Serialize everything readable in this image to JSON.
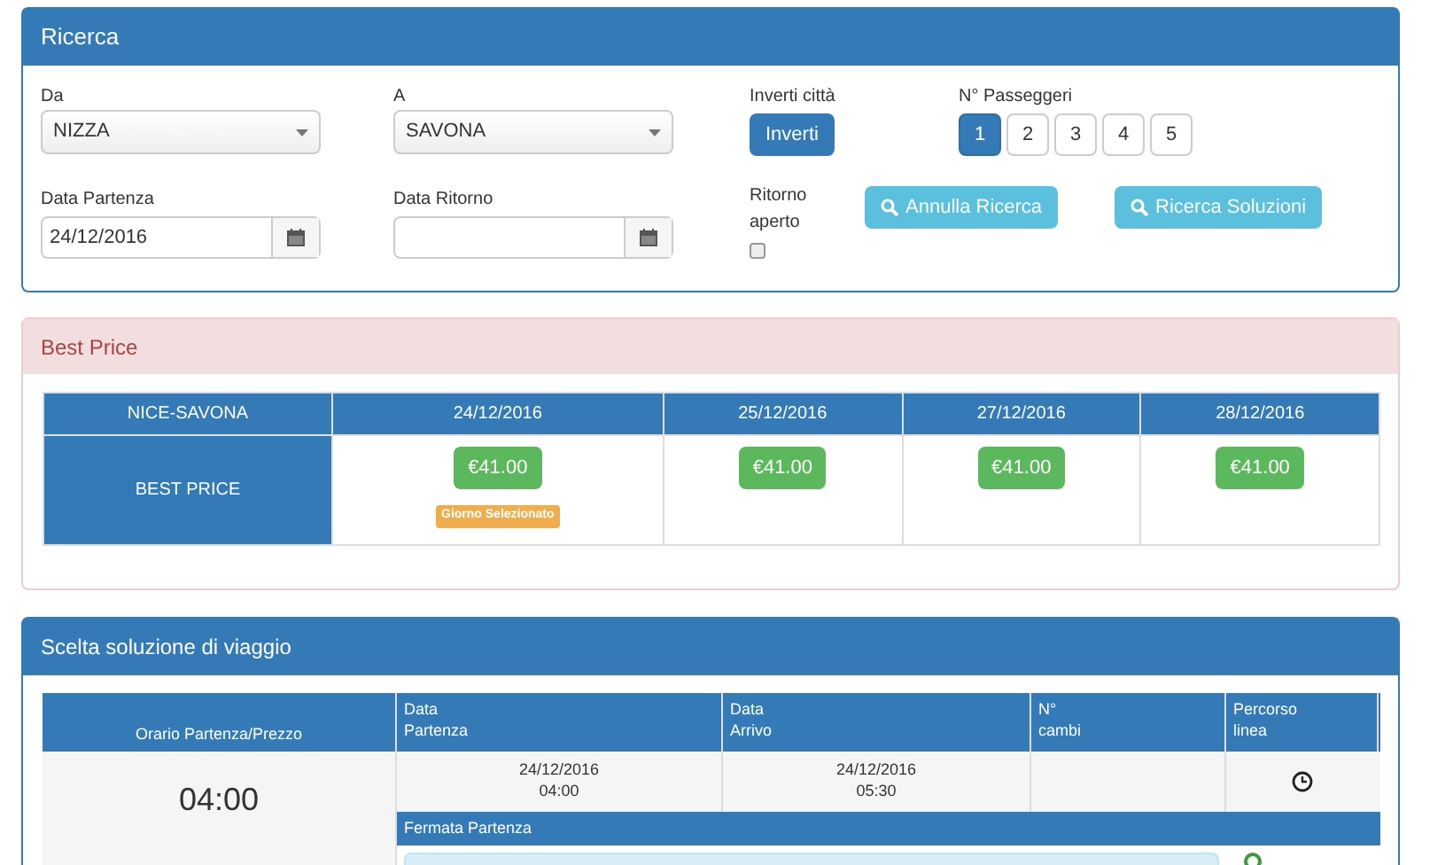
{
  "search_panel": {
    "title": "Ricerca",
    "from": {
      "label": "Da",
      "value": "NIZZA"
    },
    "to": {
      "label": "A",
      "value": "SAVONA"
    },
    "swap": {
      "label": "Inverti città",
      "button": "Inverti"
    },
    "passengers": {
      "label": "N° Passeggeri",
      "options": [
        {
          "label": "1",
          "selected": true
        },
        {
          "label": "2",
          "selected": false
        },
        {
          "label": "3",
          "selected": false
        },
        {
          "label": "4",
          "selected": false
        },
        {
          "label": "5",
          "selected": false
        }
      ]
    },
    "departure_date": {
      "label": "Data Partenza",
      "value": "24/12/2016"
    },
    "return_date": {
      "label": "Data Ritorno"
    },
    "open_return": {
      "label": "Ritorno aperto",
      "checked": false
    },
    "buttons": [
      "Annulla Ricerca",
      "Ricerca Soluzioni"
    ]
  },
  "best_price_panel": {
    "title": "Best Price",
    "route": "NICE-SAVONA",
    "row_label": "BEST PRICE",
    "days": [
      {
        "date": "24/12/2016",
        "price": "€41.00",
        "badge": "Giorno Selezionato"
      },
      {
        "date": "25/12/2016",
        "price": "€41.00"
      },
      {
        "date": "27/12/2016",
        "price": "€41.00"
      },
      {
        "date": "28/12/2016",
        "price": "€41.00"
      }
    ]
  },
  "solutions_panel": {
    "title": "Scelta soluzione di viaggio",
    "columns": [
      "Orario Partenza/Prezzo",
      "Data\nPartenza",
      "Data\nArrivo",
      "N°\ncambi",
      "Percorso\nlinea"
    ],
    "rows": [
      {
        "time": "04:00",
        "departure": "24/12/2016\n04:00",
        "arrival": "24/12/2016\n05:30",
        "stop_header": "Fermata Partenza"
      }
    ]
  }
}
